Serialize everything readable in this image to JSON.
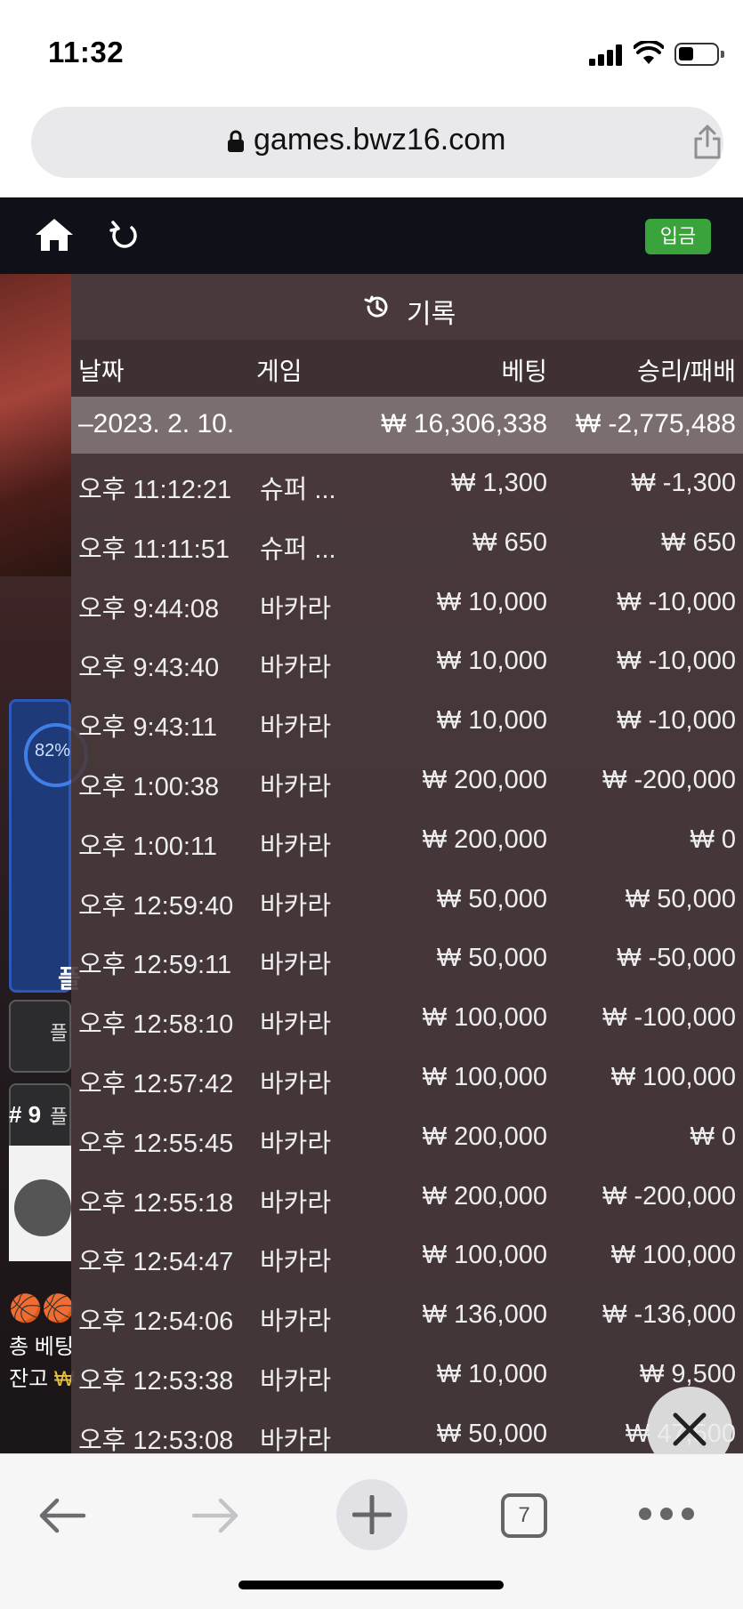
{
  "status": {
    "time": "11:32"
  },
  "browser": {
    "url": "games.bwz16.com",
    "tab_count": "7"
  },
  "site": {
    "deposit_label": "입금"
  },
  "background": {
    "percent": "82%",
    "panel_glyph": "플",
    "btn1": "플",
    "btn2": "플",
    "table_number": "# 9",
    "total_bet_label": "총 베팅",
    "balance_label": "잔고",
    "balance_currency": "₩"
  },
  "history": {
    "title": "기록",
    "headers": {
      "date": "날짜",
      "game": "게임",
      "bet": "베팅",
      "winloss": "승리/패배"
    },
    "summary": {
      "date": "–2023. 2. 10.",
      "bet": "₩ 16,306,338",
      "winloss": "₩ -2,775,488"
    },
    "rows": [
      {
        "time": "오후 11:12:21",
        "game": "슈퍼 ...",
        "bet": "₩ 1,300",
        "winloss": "₩ -1,300"
      },
      {
        "time": "오후 11:11:51",
        "game": "슈퍼 ...",
        "bet": "₩ 650",
        "winloss": "₩ 650"
      },
      {
        "time": "오후 9:44:08",
        "game": "바카라",
        "bet": "₩ 10,000",
        "winloss": "₩ -10,000"
      },
      {
        "time": "오후 9:43:40",
        "game": "바카라",
        "bet": "₩ 10,000",
        "winloss": "₩ -10,000"
      },
      {
        "time": "오후 9:43:11",
        "game": "바카라",
        "bet": "₩ 10,000",
        "winloss": "₩ -10,000"
      },
      {
        "time": "오후 1:00:38",
        "game": "바카라",
        "bet": "₩ 200,000",
        "winloss": "₩ -200,000"
      },
      {
        "time": "오후 1:00:11",
        "game": "바카라",
        "bet": "₩ 200,000",
        "winloss": "₩ 0"
      },
      {
        "time": "오후 12:59:40",
        "game": "바카라",
        "bet": "₩ 50,000",
        "winloss": "₩ 50,000"
      },
      {
        "time": "오후 12:59:11",
        "game": "바카라",
        "bet": "₩ 50,000",
        "winloss": "₩ -50,000"
      },
      {
        "time": "오후 12:58:10",
        "game": "바카라",
        "bet": "₩ 100,000",
        "winloss": "₩ -100,000"
      },
      {
        "time": "오후 12:57:42",
        "game": "바카라",
        "bet": "₩ 100,000",
        "winloss": "₩ 100,000"
      },
      {
        "time": "오후 12:55:45",
        "game": "바카라",
        "bet": "₩ 200,000",
        "winloss": "₩ 0"
      },
      {
        "time": "오후 12:55:18",
        "game": "바카라",
        "bet": "₩ 200,000",
        "winloss": "₩ -200,000"
      },
      {
        "time": "오후 12:54:47",
        "game": "바카라",
        "bet": "₩ 100,000",
        "winloss": "₩ 100,000"
      },
      {
        "time": "오후 12:54:06",
        "game": "바카라",
        "bet": "₩ 136,000",
        "winloss": "₩ -136,000"
      },
      {
        "time": "오후 12:53:38",
        "game": "바카라",
        "bet": "₩ 10,000",
        "winloss": "₩ 9,500"
      },
      {
        "time": "오후 12:53:08",
        "game": "바카라",
        "bet": "₩ 50,000",
        "winloss": "₩ 47,500"
      }
    ]
  },
  "colors": {
    "deposit": "#3aa33b",
    "nav_bg": "#0e1118",
    "overlay": "#483a3c"
  },
  "icons": [
    "signal-icon",
    "wifi-icon",
    "battery-icon",
    "lock-icon",
    "share-icon",
    "home-icon",
    "reload-icon",
    "history-icon",
    "close-icon",
    "back-icon",
    "forward-icon",
    "plus-icon",
    "tabs-icon",
    "more-icon"
  ]
}
